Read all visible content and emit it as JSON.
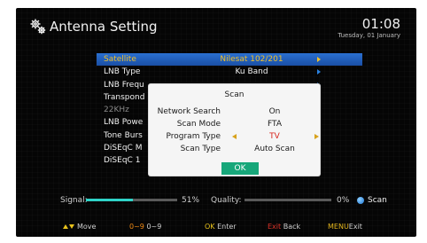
{
  "header": {
    "title": "Antenna Setting",
    "time": "01:08",
    "date": "Tuesday, 01 January",
    "icon": "gear-icon"
  },
  "menu": {
    "items": [
      {
        "label": "Satellite",
        "value": "Nilesat 102/201"
      },
      {
        "label": "LNB Type",
        "value": "Ku Band"
      },
      {
        "label": "LNB Frequ",
        "value": ""
      },
      {
        "label": "Transpond",
        "value": ""
      },
      {
        "label": "22KHz",
        "value": ""
      },
      {
        "label": "LNB Powe",
        "value": ""
      },
      {
        "label": "Tone Burs",
        "value": ""
      },
      {
        "label": "DiSEqC M",
        "value": ""
      },
      {
        "label": "DiSEqC 1",
        "value": ""
      }
    ]
  },
  "dialog": {
    "title": "Scan",
    "rows": [
      {
        "label": "Network Search",
        "value": "On"
      },
      {
        "label": "Scan Mode",
        "value": "FTA"
      },
      {
        "label": "Program Type",
        "value": "TV"
      },
      {
        "label": "Scan Type",
        "value": "Auto Scan"
      }
    ],
    "ok_label": "OK"
  },
  "status": {
    "signal_label": "Signal:",
    "signal_percent": "51%",
    "signal_value": 0.51,
    "quality_label": "Quality:",
    "quality_percent": "0%",
    "quality_value": 0,
    "scan_label": "Scan"
  },
  "footer": {
    "move_label": "Move",
    "digits_key": "0~9",
    "digits_label": "0~9",
    "ok_key": "OK",
    "enter_label": "Enter",
    "exit_key": "Exit",
    "back_label": "Back",
    "menu_key": "MENU",
    "menu_exit_label": "Exit"
  },
  "colors": {
    "selection": "#2a6fd1",
    "highlight_text": "#f2c12a",
    "ok_button": "#17a77a",
    "signal_bar": "#2fd3c8",
    "program_value": "#d7241c"
  }
}
